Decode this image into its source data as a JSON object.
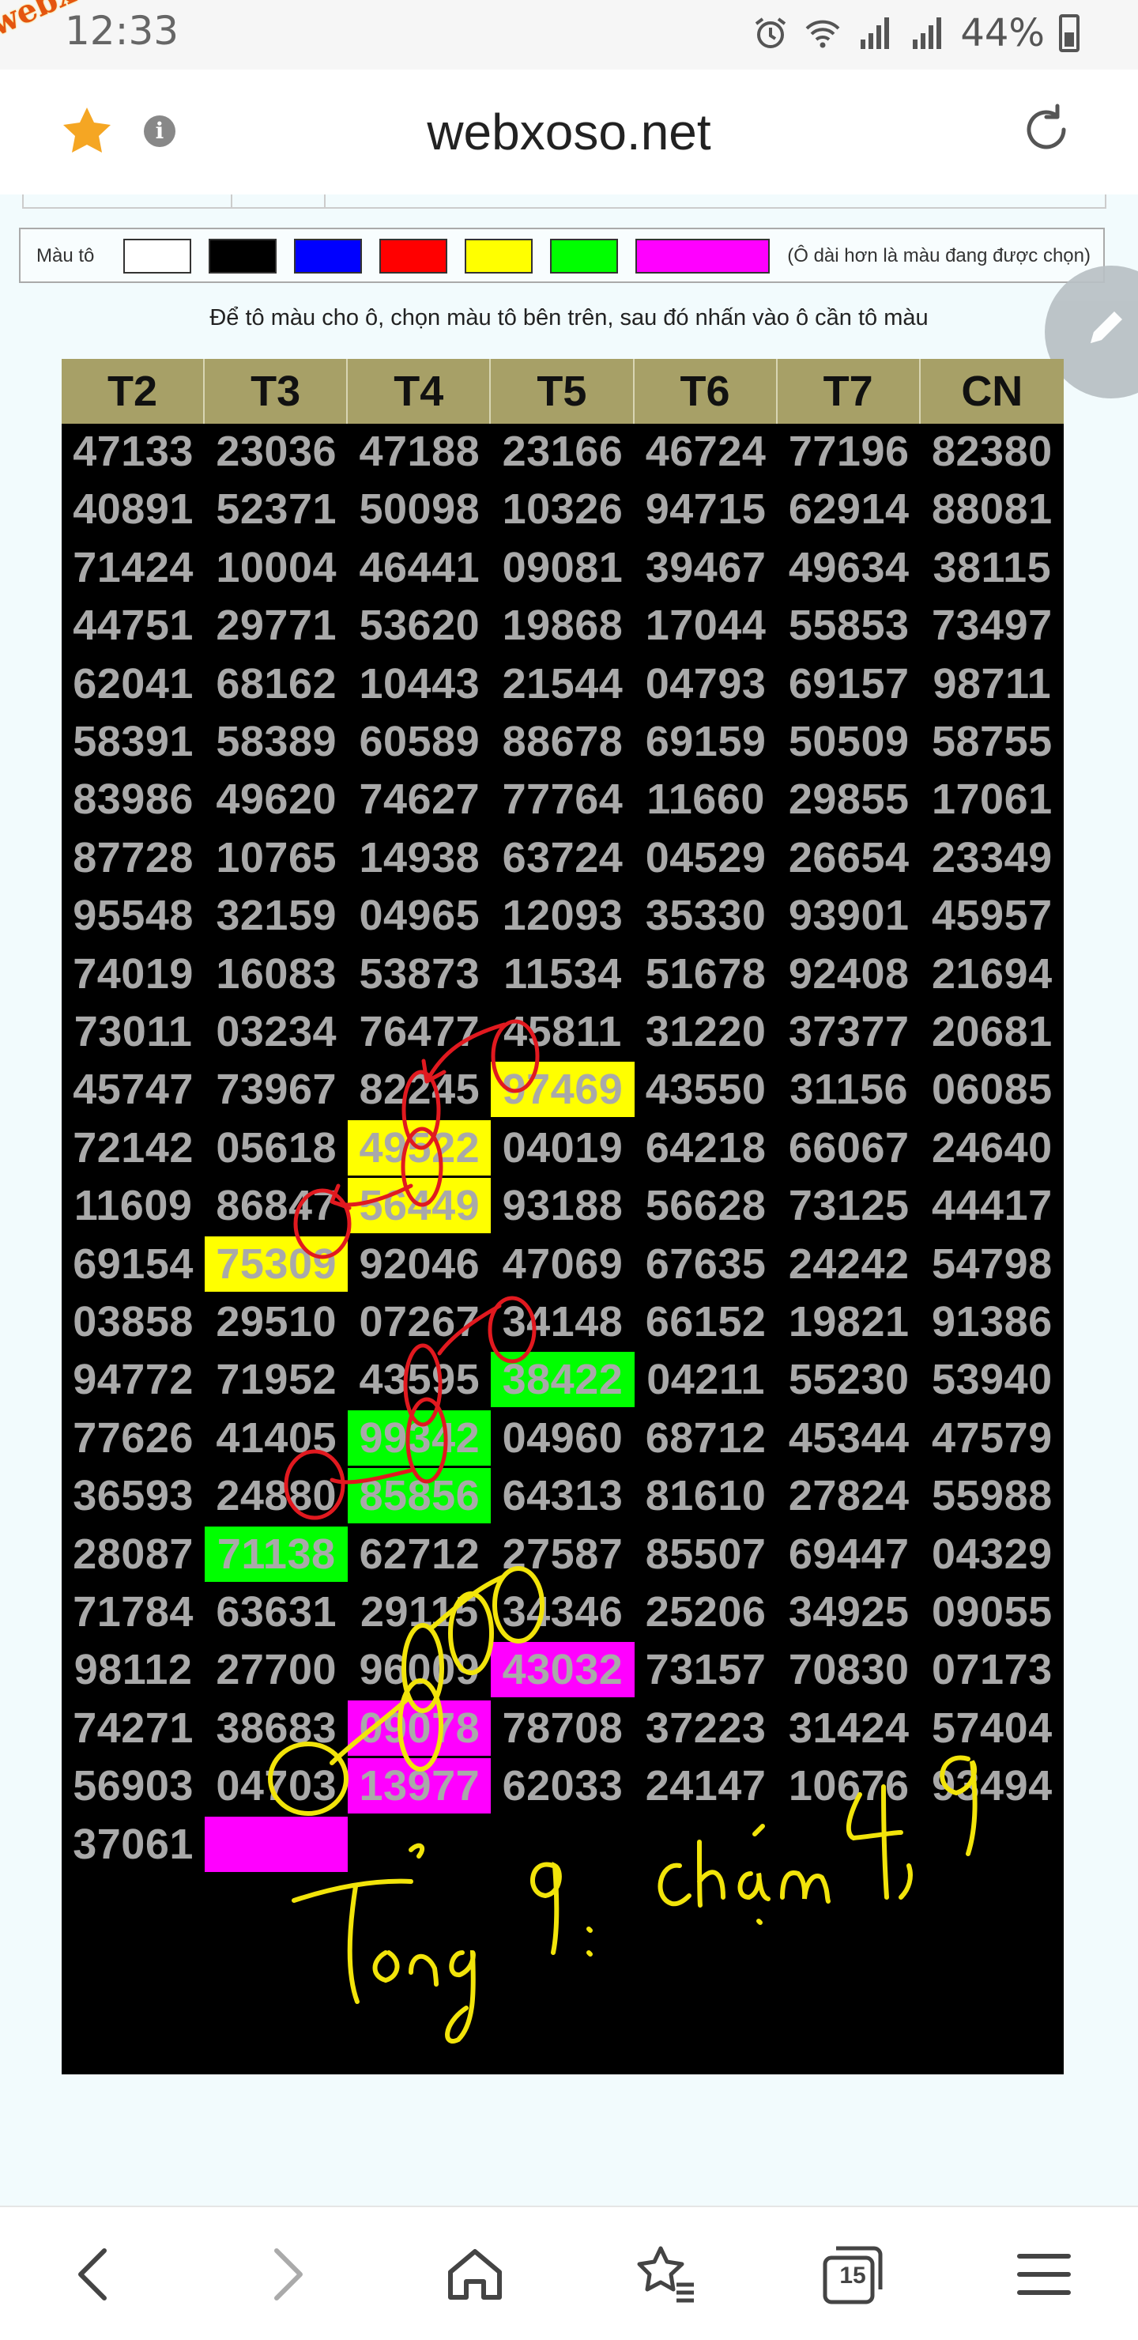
{
  "status_bar": {
    "time": "12:33",
    "battery": "44%",
    "watermark": "webxoso.net"
  },
  "browser": {
    "url": "webxoso.net"
  },
  "palette": {
    "label": "Màu tô",
    "hint": "(Ô dài hơn là màu đang được chọn)",
    "colors": [
      "#ffffff",
      "#000000",
      "#0000ff",
      "#ff0000",
      "#ffff00",
      "#00ff00",
      "#ff00ff"
    ],
    "selected_index": 6
  },
  "instruction": "Để tô màu cho ô, chọn màu tô bên trên, sau đó nhấn vào ô cần tô màu",
  "grid": {
    "headers": [
      "T2",
      "T3",
      "T4",
      "T5",
      "T6",
      "T7",
      "CN"
    ],
    "rows": [
      [
        "47133",
        "23036",
        "47188",
        "23166",
        "46724",
        "77196",
        "82380"
      ],
      [
        "40891",
        "52371",
        "50098",
        "10326",
        "94715",
        "62914",
        "88081"
      ],
      [
        "71424",
        "10004",
        "46441",
        "09081",
        "39467",
        "49634",
        "38115"
      ],
      [
        "44751",
        "29771",
        "53620",
        "19868",
        "17044",
        "55853",
        "73497"
      ],
      [
        "62041",
        "68162",
        "10443",
        "21544",
        "04793",
        "69157",
        "98711"
      ],
      [
        "58391",
        "58389",
        "60589",
        "88678",
        "69159",
        "50509",
        "58755"
      ],
      [
        "83986",
        "49620",
        "74627",
        "77764",
        "11660",
        "29855",
        "17061"
      ],
      [
        "87728",
        "10765",
        "14938",
        "63724",
        "04529",
        "26654",
        "23349"
      ],
      [
        "95548",
        "32159",
        "04965",
        "12093",
        "35330",
        "93901",
        "45957"
      ],
      [
        "74019",
        "16083",
        "53873",
        "11534",
        "51678",
        "92408",
        "21694"
      ],
      [
        "73011",
        "03234",
        "76477",
        "45811",
        "31220",
        "37377",
        "20681"
      ],
      [
        "45747",
        "73967",
        "82245",
        "97469",
        "43550",
        "31156",
        "06085"
      ],
      [
        "72142",
        "05618",
        "49522",
        "04019",
        "64218",
        "66067",
        "24640"
      ],
      [
        "11609",
        "86847",
        "56449",
        "93188",
        "56628",
        "73125",
        "44417"
      ],
      [
        "69154",
        "75309",
        "92046",
        "47069",
        "67635",
        "24242",
        "54798"
      ],
      [
        "03858",
        "29510",
        "07267",
        "34148",
        "66152",
        "19821",
        "91386"
      ],
      [
        "94772",
        "71952",
        "43595",
        "38422",
        "04211",
        "55230",
        "53940"
      ],
      [
        "77626",
        "41405",
        "99342",
        "04960",
        "68712",
        "45344",
        "47579"
      ],
      [
        "36593",
        "24880",
        "85856",
        "64313",
        "81610",
        "27824",
        "55988"
      ],
      [
        "28087",
        "71138",
        "62712",
        "27587",
        "85507",
        "69447",
        "04329"
      ],
      [
        "71784",
        "63631",
        "29115",
        "34346",
        "25206",
        "34925",
        "09055"
      ],
      [
        "98112",
        "27700",
        "96009",
        "43032",
        "73157",
        "70830",
        "07173"
      ],
      [
        "74271",
        "38683",
        "09078",
        "78708",
        "37223",
        "31424",
        "57404"
      ],
      [
        "56903",
        "04703",
        "13977",
        "62033",
        "24147",
        "10676",
        "93494"
      ],
      [
        "37061",
        "",
        "",
        "",
        "",
        "",
        ""
      ]
    ],
    "highlights": [
      {
        "row": 11,
        "col": 3,
        "color": "yellow"
      },
      {
        "row": 12,
        "col": 2,
        "color": "yellow"
      },
      {
        "row": 13,
        "col": 2,
        "color": "yellow"
      },
      {
        "row": 14,
        "col": 1,
        "color": "yellow"
      },
      {
        "row": 16,
        "col": 3,
        "color": "green"
      },
      {
        "row": 17,
        "col": 2,
        "color": "green"
      },
      {
        "row": 18,
        "col": 2,
        "color": "green"
      },
      {
        "row": 19,
        "col": 1,
        "color": "green"
      },
      {
        "row": 21,
        "col": 3,
        "color": "magenta"
      },
      {
        "row": 22,
        "col": 2,
        "color": "magenta"
      },
      {
        "row": 23,
        "col": 2,
        "color": "magenta"
      },
      {
        "row": 24,
        "col": 1,
        "color": "magenta"
      }
    ]
  },
  "handwriting": {
    "cell_note": "09",
    "note": "Tổng 9 : chạm 4,9"
  },
  "bottom_nav": {
    "tab_count": "15"
  },
  "icons": [
    "star-icon",
    "info-icon",
    "reload-icon",
    "edit-icon",
    "back-icon",
    "forward-icon",
    "home-icon",
    "bookmarks-icon",
    "tabs-icon",
    "menu-icon",
    "alarm-icon",
    "wifi-icon",
    "signal-icon",
    "battery-icon"
  ]
}
